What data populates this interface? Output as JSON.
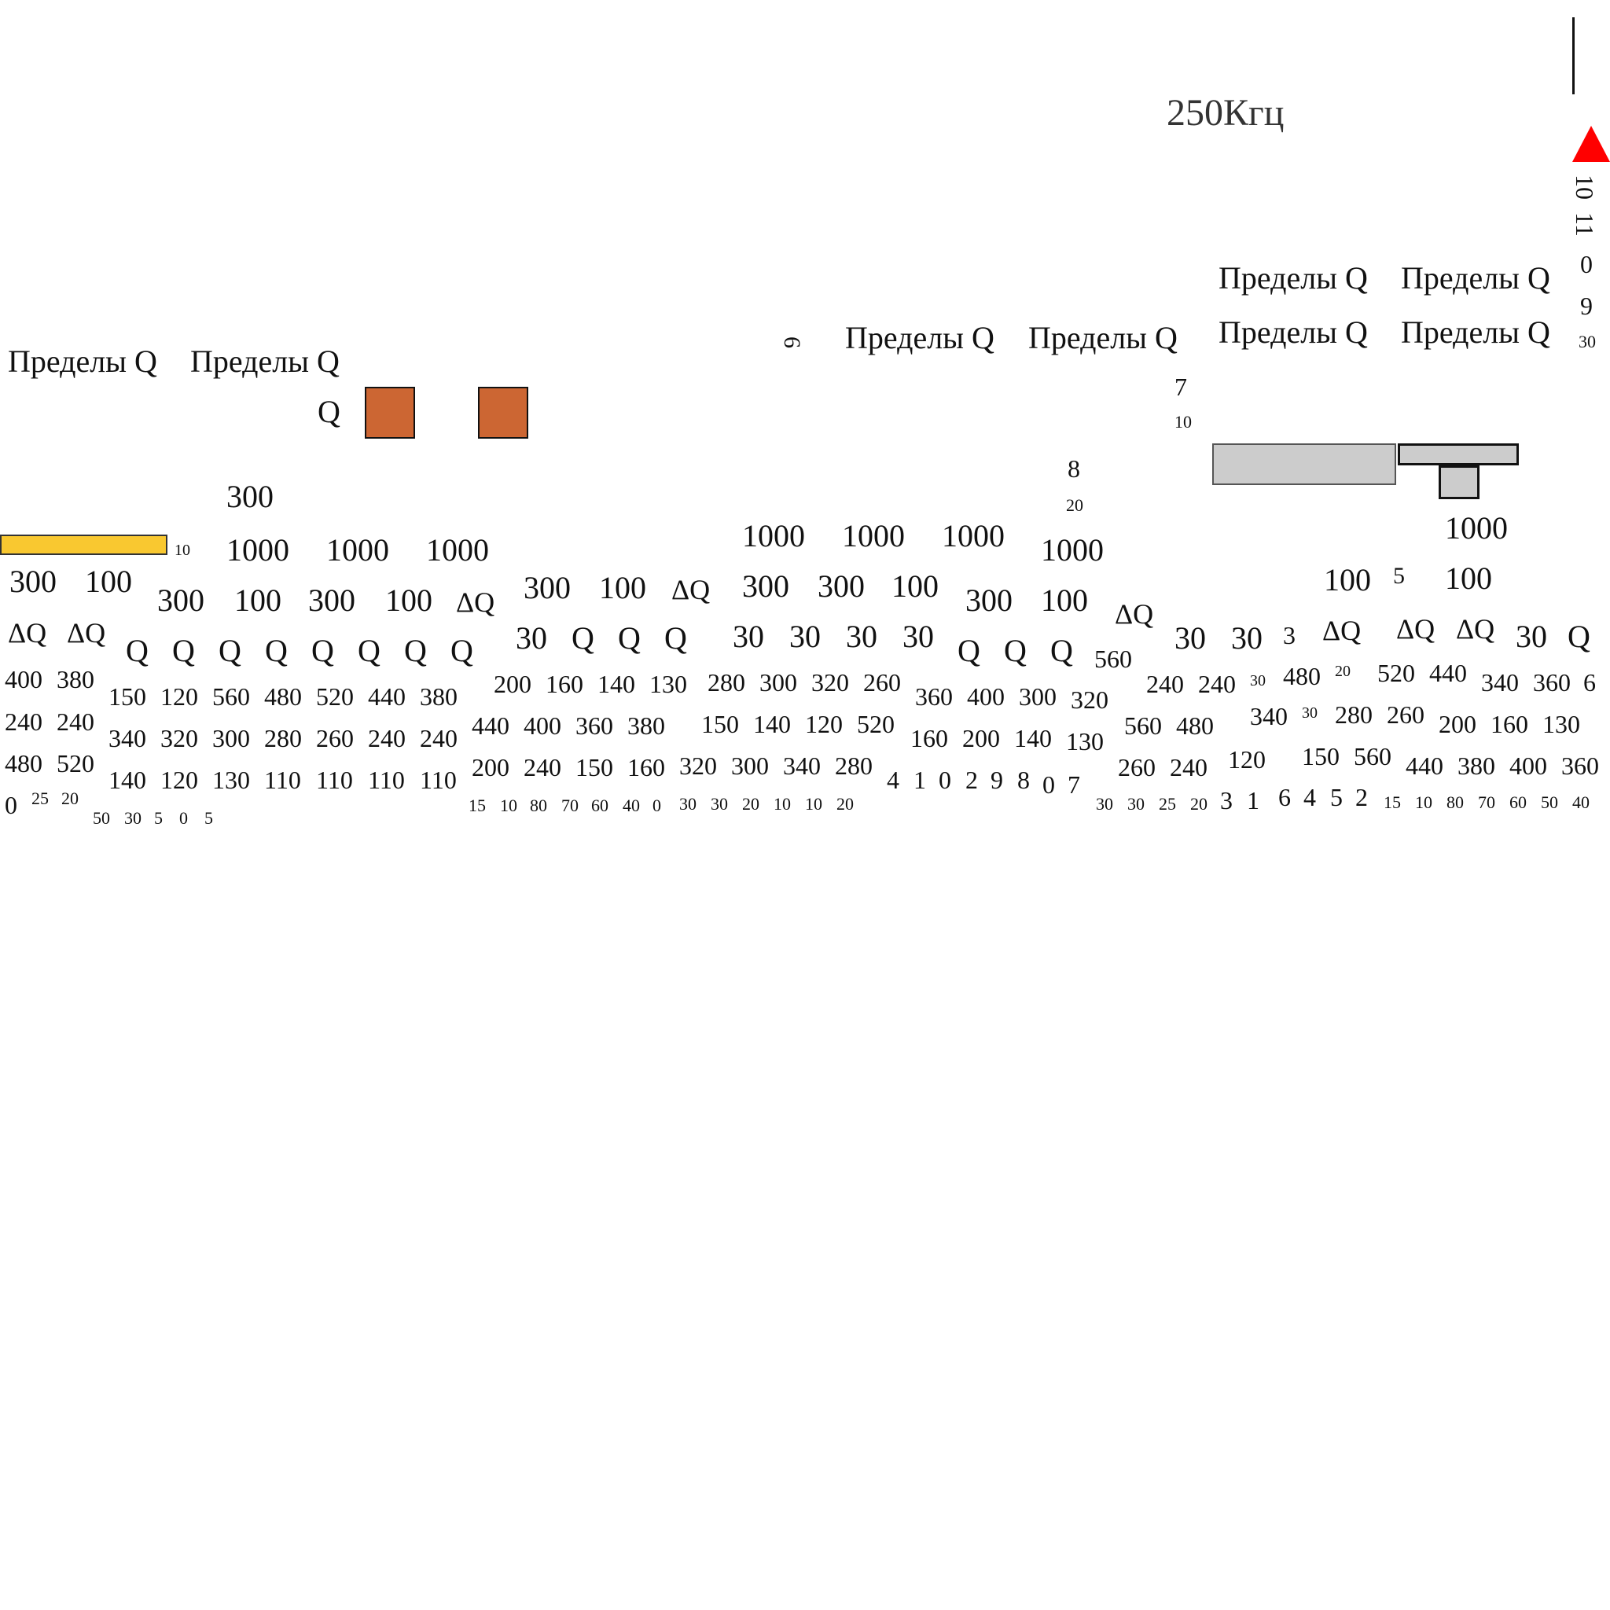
{
  "header": {
    "frequency": "250Кгц"
  },
  "vertical_digits": {
    "a": "10",
    "b": "11",
    "c": "0",
    "d": "9",
    "e": "30",
    "six": "6"
  },
  "limits_label": "Пределы Q",
  "q_label": "Q",
  "dq_label": "ΔQ",
  "colors": {
    "yellow": "#f9c830",
    "orange": "#cc6633",
    "gray": "#cccccc",
    "red": "#ff0000"
  },
  "left": {
    "row300_100": [
      "300",
      "100"
    ],
    "dq": [
      "ΔQ",
      "ΔQ"
    ],
    "nums1": [
      "400",
      "380"
    ],
    "nums2": [
      "240",
      "240"
    ],
    "nums3": [
      "480",
      "520"
    ],
    "small": [
      "0",
      "25",
      "20"
    ],
    "yellow_small": "10"
  },
  "group2": {
    "top300": "300",
    "row1000": [
      "1000",
      "1000",
      "1000"
    ],
    "row300_100": [
      "300",
      "100",
      "300",
      "100",
      "ΔQ"
    ],
    "q_row": [
      "Q",
      "Q",
      "Q",
      "Q",
      "Q",
      "Q",
      "Q",
      "Q"
    ],
    "nums1": [
      "150",
      "120",
      "560",
      "480",
      "520",
      "440",
      "380"
    ],
    "nums2": [
      "340",
      "320",
      "300",
      "280",
      "260",
      "240",
      "240"
    ],
    "nums3": [
      "140",
      "120",
      "130",
      "110",
      "110",
      "110",
      "110"
    ],
    "small": [
      "50",
      "30",
      "5",
      "0",
      "5"
    ]
  },
  "group3": {
    "row300_100": [
      "300",
      "100",
      "ΔQ"
    ],
    "q_row": [
      "30",
      "Q",
      "Q",
      "Q"
    ],
    "nums1": [
      "200",
      "160",
      "140",
      "130"
    ],
    "nums2": [
      "440",
      "400",
      "360",
      "380"
    ],
    "nums3": [
      "200",
      "240",
      "150",
      "160"
    ],
    "small": [
      "15",
      "10",
      "80",
      "70",
      "60",
      "40",
      "0"
    ]
  },
  "group4": {
    "row1000": [
      "1000",
      "1000",
      "1000"
    ],
    "row300": [
      "300",
      "300",
      "100"
    ],
    "row30": [
      "30",
      "30",
      "30",
      "30"
    ],
    "nums1": [
      "280",
      "300",
      "320",
      "260"
    ],
    "nums2": [
      "150",
      "140",
      "120",
      "520"
    ],
    "nums3": [
      "320",
      "300",
      "340",
      "280"
    ],
    "small": [
      "30",
      "30",
      "20",
      "10",
      "10",
      "20"
    ]
  },
  "group5": {
    "seven": "7",
    "ten": "10",
    "eight": "8",
    "twenty": "20",
    "k1000": "1000",
    "row300_100": [
      "300",
      "100"
    ],
    "dq": "ΔQ",
    "q_row": [
      "Q",
      "Q",
      "Q"
    ],
    "n560": "560",
    "nums1": [
      "360",
      "400",
      "300",
      "320"
    ],
    "nums2": [
      "160",
      "200",
      "140",
      "130"
    ],
    "digits": [
      "4",
      "1",
      "0",
      "2",
      "9",
      "8",
      "0",
      "7"
    ]
  },
  "group6": {
    "row30": [
      "30",
      "30",
      "3"
    ],
    "dq": [
      "ΔQ",
      "ΔQ",
      "ΔQ"
    ],
    "r100": [
      "100",
      "5",
      "100"
    ],
    "k1000": "1000",
    "q30": [
      "30",
      "Q"
    ],
    "nums1": [
      "240",
      "240",
      "30",
      "480",
      "20",
      "520",
      "440",
      "340",
      "360",
      "6"
    ],
    "nums2": [
      "560",
      "480",
      "340",
      "30",
      "280",
      "260",
      "200",
      "160",
      "130"
    ],
    "nums3": [
      "260",
      "240",
      "120",
      "150",
      "560",
      "440",
      "380",
      "400",
      "360"
    ],
    "digits": [
      "3",
      "1",
      "6",
      "4",
      "5",
      "2"
    ],
    "small": [
      "30",
      "30",
      "25",
      "20",
      "15",
      "10",
      "80",
      "70",
      "60",
      "50",
      "40"
    ]
  }
}
